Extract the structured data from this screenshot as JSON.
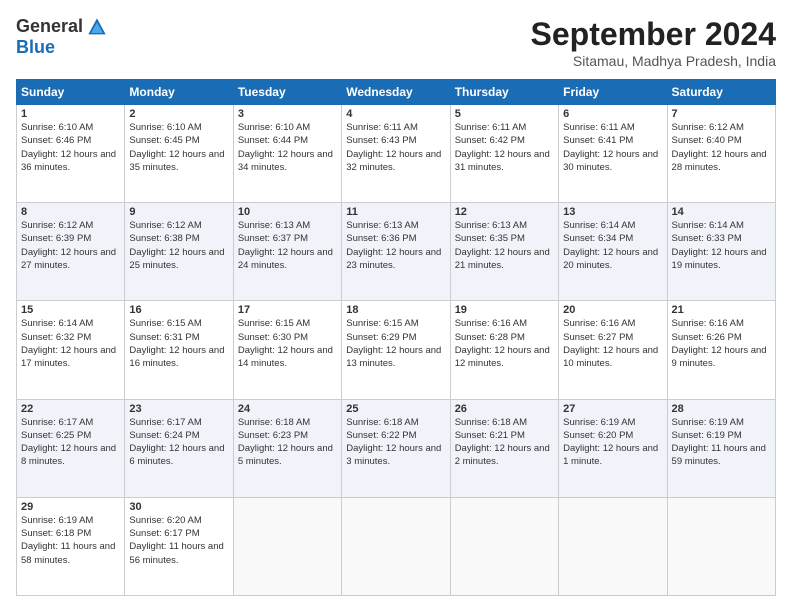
{
  "logo": {
    "general": "General",
    "blue": "Blue"
  },
  "title": "September 2024",
  "location": "Sitamau, Madhya Pradesh, India",
  "days": [
    "Sunday",
    "Monday",
    "Tuesday",
    "Wednesday",
    "Thursday",
    "Friday",
    "Saturday"
  ],
  "weeks": [
    [
      {
        "day": 1,
        "sunrise": "6:10 AM",
        "sunset": "6:46 PM",
        "daylight": "12 hours and 36 minutes."
      },
      {
        "day": 2,
        "sunrise": "6:10 AM",
        "sunset": "6:45 PM",
        "daylight": "12 hours and 35 minutes."
      },
      {
        "day": 3,
        "sunrise": "6:10 AM",
        "sunset": "6:44 PM",
        "daylight": "12 hours and 34 minutes."
      },
      {
        "day": 4,
        "sunrise": "6:11 AM",
        "sunset": "6:43 PM",
        "daylight": "12 hours and 32 minutes."
      },
      {
        "day": 5,
        "sunrise": "6:11 AM",
        "sunset": "6:42 PM",
        "daylight": "12 hours and 31 minutes."
      },
      {
        "day": 6,
        "sunrise": "6:11 AM",
        "sunset": "6:41 PM",
        "daylight": "12 hours and 30 minutes."
      },
      {
        "day": 7,
        "sunrise": "6:12 AM",
        "sunset": "6:40 PM",
        "daylight": "12 hours and 28 minutes."
      }
    ],
    [
      {
        "day": 8,
        "sunrise": "6:12 AM",
        "sunset": "6:39 PM",
        "daylight": "12 hours and 27 minutes."
      },
      {
        "day": 9,
        "sunrise": "6:12 AM",
        "sunset": "6:38 PM",
        "daylight": "12 hours and 25 minutes."
      },
      {
        "day": 10,
        "sunrise": "6:13 AM",
        "sunset": "6:37 PM",
        "daylight": "12 hours and 24 minutes."
      },
      {
        "day": 11,
        "sunrise": "6:13 AM",
        "sunset": "6:36 PM",
        "daylight": "12 hours and 23 minutes."
      },
      {
        "day": 12,
        "sunrise": "6:13 AM",
        "sunset": "6:35 PM",
        "daylight": "12 hours and 21 minutes."
      },
      {
        "day": 13,
        "sunrise": "6:14 AM",
        "sunset": "6:34 PM",
        "daylight": "12 hours and 20 minutes."
      },
      {
        "day": 14,
        "sunrise": "6:14 AM",
        "sunset": "6:33 PM",
        "daylight": "12 hours and 19 minutes."
      }
    ],
    [
      {
        "day": 15,
        "sunrise": "6:14 AM",
        "sunset": "6:32 PM",
        "daylight": "12 hours and 17 minutes."
      },
      {
        "day": 16,
        "sunrise": "6:15 AM",
        "sunset": "6:31 PM",
        "daylight": "12 hours and 16 minutes."
      },
      {
        "day": 17,
        "sunrise": "6:15 AM",
        "sunset": "6:30 PM",
        "daylight": "12 hours and 14 minutes."
      },
      {
        "day": 18,
        "sunrise": "6:15 AM",
        "sunset": "6:29 PM",
        "daylight": "12 hours and 13 minutes."
      },
      {
        "day": 19,
        "sunrise": "6:16 AM",
        "sunset": "6:28 PM",
        "daylight": "12 hours and 12 minutes."
      },
      {
        "day": 20,
        "sunrise": "6:16 AM",
        "sunset": "6:27 PM",
        "daylight": "12 hours and 10 minutes."
      },
      {
        "day": 21,
        "sunrise": "6:16 AM",
        "sunset": "6:26 PM",
        "daylight": "12 hours and 9 minutes."
      }
    ],
    [
      {
        "day": 22,
        "sunrise": "6:17 AM",
        "sunset": "6:25 PM",
        "daylight": "12 hours and 8 minutes."
      },
      {
        "day": 23,
        "sunrise": "6:17 AM",
        "sunset": "6:24 PM",
        "daylight": "12 hours and 6 minutes."
      },
      {
        "day": 24,
        "sunrise": "6:18 AM",
        "sunset": "6:23 PM",
        "daylight": "12 hours and 5 minutes."
      },
      {
        "day": 25,
        "sunrise": "6:18 AM",
        "sunset": "6:22 PM",
        "daylight": "12 hours and 3 minutes."
      },
      {
        "day": 26,
        "sunrise": "6:18 AM",
        "sunset": "6:21 PM",
        "daylight": "12 hours and 2 minutes."
      },
      {
        "day": 27,
        "sunrise": "6:19 AM",
        "sunset": "6:20 PM",
        "daylight": "12 hours and 1 minute."
      },
      {
        "day": 28,
        "sunrise": "6:19 AM",
        "sunset": "6:19 PM",
        "daylight": "11 hours and 59 minutes."
      }
    ],
    [
      {
        "day": 29,
        "sunrise": "6:19 AM",
        "sunset": "6:18 PM",
        "daylight": "11 hours and 58 minutes."
      },
      {
        "day": 30,
        "sunrise": "6:20 AM",
        "sunset": "6:17 PM",
        "daylight": "11 hours and 56 minutes."
      },
      null,
      null,
      null,
      null,
      null
    ]
  ]
}
